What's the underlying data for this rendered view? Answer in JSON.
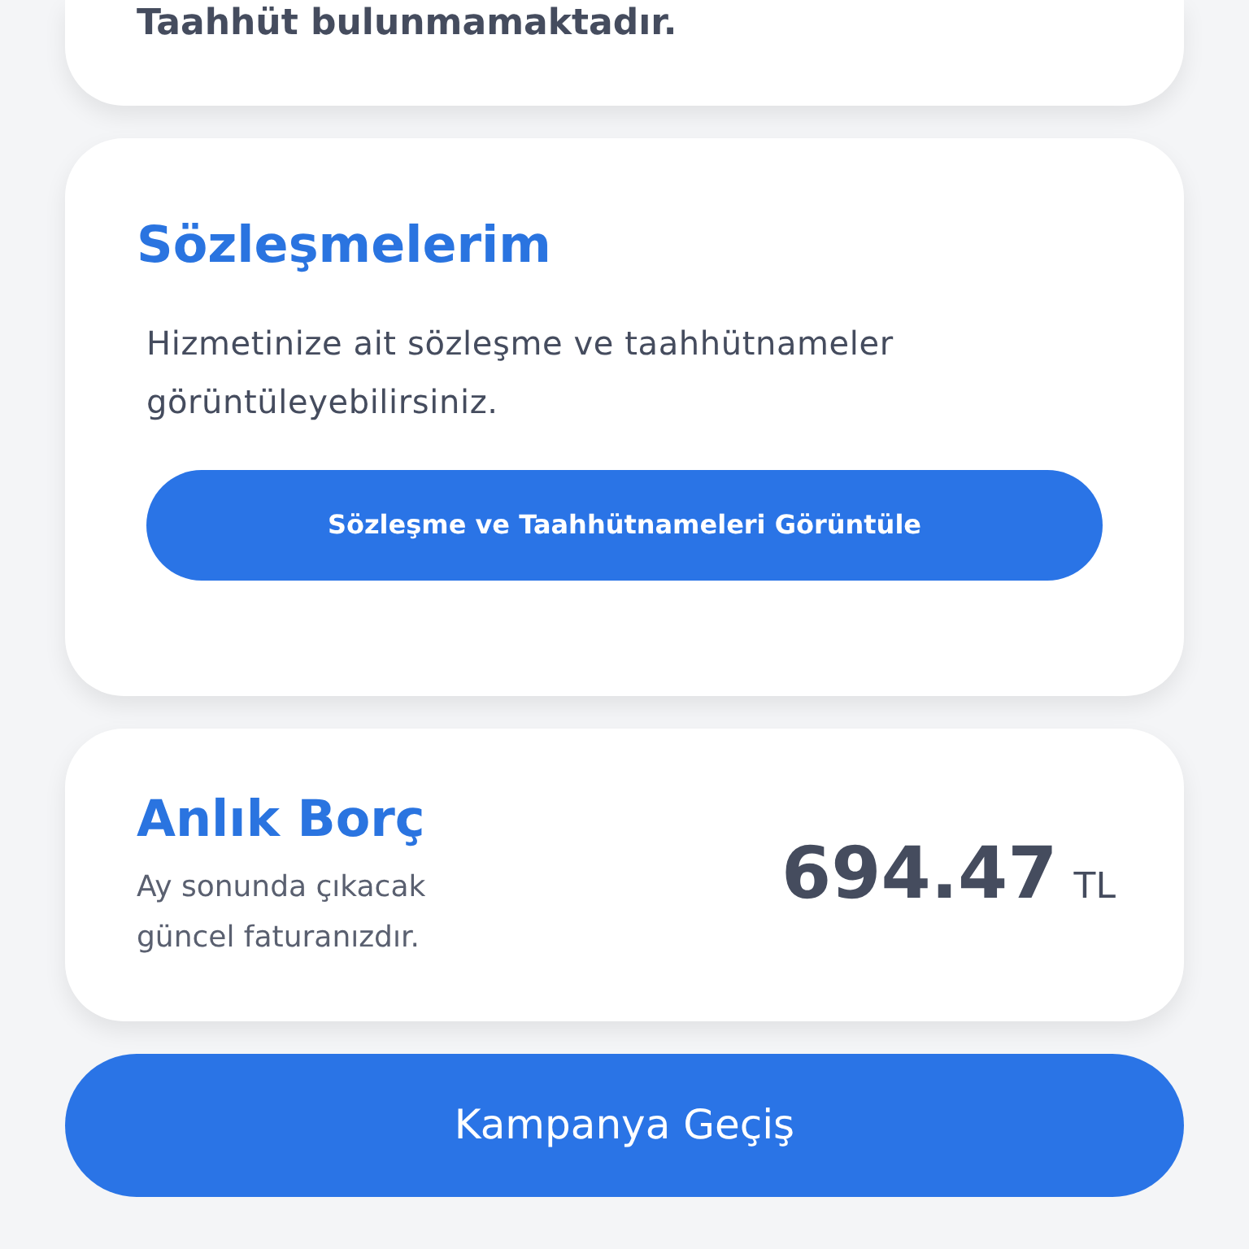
{
  "commitment_card": {
    "message": "Taahhüt bulunmamaktadır."
  },
  "contracts_card": {
    "title": "Sözleşmelerim",
    "description": "Hizmetinize ait sözleşme ve taahhütnameler görüntüleyebilirsiniz.",
    "button": "Sözleşme ve Taahhütnameleri Görüntüle"
  },
  "debt_card": {
    "title": "Anlık Borç",
    "description": "Ay sonunda çıkacak güncel faturanızdır.",
    "amount": "694.47",
    "currency": "TL"
  },
  "campaign_button": "Kampanya Geçiş"
}
